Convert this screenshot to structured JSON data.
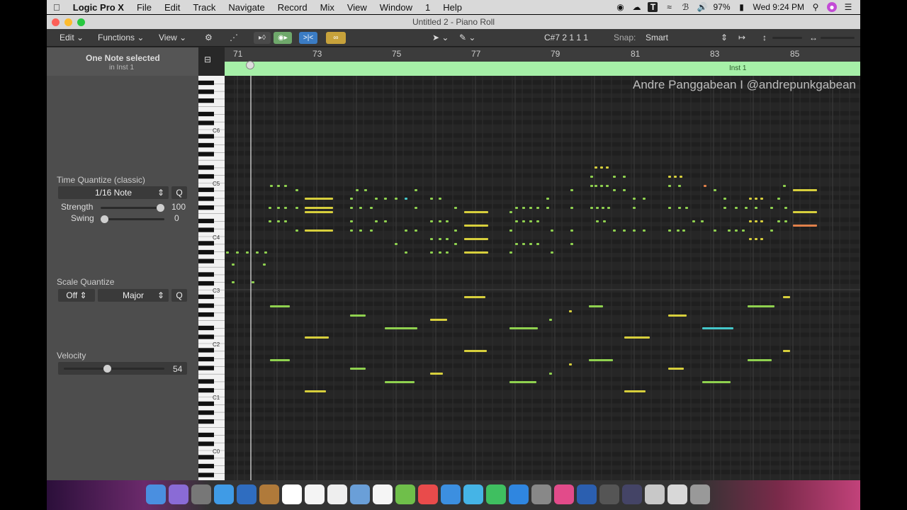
{
  "menubar": {
    "app": "Logic Pro X",
    "items": [
      "File",
      "Edit",
      "Track",
      "Navigate",
      "Record",
      "Mix",
      "View",
      "Window",
      "1",
      "Help"
    ],
    "battery": "97%",
    "clock": "Wed 9:24 PM"
  },
  "window": {
    "title": "Untitled 2 - Piano Roll"
  },
  "toolbar": {
    "edit": "Edit",
    "functions": "Functions",
    "view": "View",
    "position": "C#7  2 1 1 1",
    "snap_label": "Snap:",
    "snap_value": "Smart"
  },
  "inspector": {
    "selection": "One Note selected",
    "selection_sub": "in Inst 1",
    "time_quantize_label": "Time Quantize (classic)",
    "time_quantize_value": "1/16 Note",
    "q": "Q",
    "strength_label": "Strength",
    "strength_value": "100",
    "strength_level": 1.0,
    "swing_label": "Swing",
    "swing_value": "0",
    "swing_level": 0.0,
    "scale_quantize_label": "Scale Quantize",
    "scale_off": "Off",
    "scale_mode": "Major",
    "velocity_label": "Velocity",
    "velocity_value": "54",
    "velocity_level": 0.43
  },
  "ruler": {
    "bars": [
      "71",
      "73",
      "75",
      "77",
      "79",
      "81",
      "83",
      "85"
    ]
  },
  "region": {
    "name": "Inst 1"
  },
  "keys": {
    "labels": [
      "C6",
      "C5",
      "C4",
      "C3",
      "C2",
      "C1",
      "C0"
    ]
  },
  "watermark": "Andre Panggabean I @andrepunkgabean",
  "colors": {
    "note_green": "#8fd14f",
    "note_yellow": "#d7cf3c",
    "note_cyan": "#44c6c9",
    "note_orange": "#e0804a",
    "region": "#a6f0a8"
  }
}
